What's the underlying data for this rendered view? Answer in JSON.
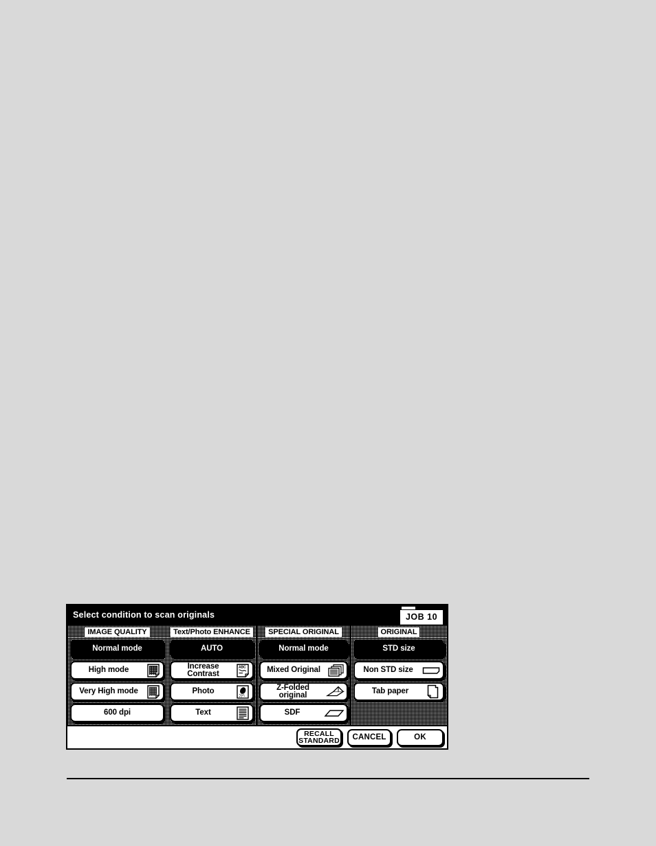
{
  "panel": {
    "title": "Select condition to scan originals",
    "job_badge": "JOB 10",
    "columns": [
      {
        "header": "IMAGE QUALITY",
        "options": [
          {
            "label": "Normal mode",
            "selected": true,
            "icon": "none"
          },
          {
            "label": "High mode",
            "selected": false,
            "icon": "dense-grid-page-icon"
          },
          {
            "label": "Very High mode",
            "selected": false,
            "icon": "fine-grid-page-icon"
          },
          {
            "label": "600 dpi",
            "selected": false,
            "icon": "none"
          }
        ]
      },
      {
        "header": "Text/Photo ENHANCE",
        "options": [
          {
            "label": "AUTO",
            "selected": true,
            "icon": "none"
          },
          {
            "label": "Increase\nContrast",
            "selected": false,
            "icon": "abc-page-icon"
          },
          {
            "label": "Photo",
            "selected": false,
            "icon": "photo-icon"
          },
          {
            "label": "Text",
            "selected": false,
            "icon": "text-lines-icon"
          }
        ]
      },
      {
        "header": "SPECIAL ORIGINAL",
        "options": [
          {
            "label": "Normal mode",
            "selected": true,
            "icon": "none"
          },
          {
            "label": "Mixed Original",
            "selected": false,
            "icon": "stacked-pages-icon"
          },
          {
            "label": "Z-Folded\noriginal",
            "selected": false,
            "icon": "z-folded-sheet-icon"
          },
          {
            "label": "SDF",
            "selected": false,
            "icon": "single-sheet-icon"
          }
        ]
      },
      {
        "header": "ORIGINAL",
        "options": [
          {
            "label": "STD size",
            "selected": true,
            "icon": "none"
          },
          {
            "label": "Non STD size",
            "selected": false,
            "icon": "landscape-sheet-icon"
          },
          {
            "label": "Tab paper",
            "selected": false,
            "icon": "tab-page-icon"
          }
        ]
      }
    ],
    "actions": {
      "recall": "RECALL\nSTANDARD",
      "cancel": "CANCEL",
      "ok": "OK"
    }
  },
  "colors": {
    "page_background": "#d9d9d9",
    "panel_background": "#ffffff",
    "ink": "#000000",
    "selected_fill": "#000000",
    "selected_text": "#ffffff"
  }
}
